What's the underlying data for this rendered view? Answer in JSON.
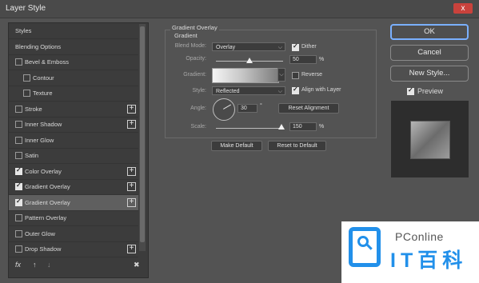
{
  "window": {
    "title": "Layer Style",
    "close_label": "x"
  },
  "styles_list": {
    "items": [
      {
        "label": "Styles",
        "checkbox": false,
        "checked": false,
        "plus": false,
        "indent": 0
      },
      {
        "label": "Blending Options",
        "checkbox": false,
        "checked": false,
        "plus": false,
        "indent": 0
      },
      {
        "label": "Bevel & Emboss",
        "checkbox": true,
        "checked": false,
        "plus": false,
        "indent": 0
      },
      {
        "label": "Contour",
        "checkbox": true,
        "checked": false,
        "plus": false,
        "indent": 1
      },
      {
        "label": "Texture",
        "checkbox": true,
        "checked": false,
        "plus": false,
        "indent": 1
      },
      {
        "label": "Stroke",
        "checkbox": true,
        "checked": false,
        "plus": true,
        "indent": 0
      },
      {
        "label": "Inner Shadow",
        "checkbox": true,
        "checked": false,
        "plus": true,
        "indent": 0
      },
      {
        "label": "Inner Glow",
        "checkbox": true,
        "checked": false,
        "plus": false,
        "indent": 0
      },
      {
        "label": "Satin",
        "checkbox": true,
        "checked": false,
        "plus": false,
        "indent": 0
      },
      {
        "label": "Color Overlay",
        "checkbox": true,
        "checked": true,
        "plus": true,
        "indent": 0
      },
      {
        "label": "Gradient Overlay",
        "checkbox": true,
        "checked": true,
        "plus": true,
        "indent": 0
      },
      {
        "label": "Gradient Overlay",
        "checkbox": true,
        "checked": true,
        "plus": true,
        "indent": 0,
        "selected": true
      },
      {
        "label": "Pattern Overlay",
        "checkbox": true,
        "checked": false,
        "plus": false,
        "indent": 0
      },
      {
        "label": "Outer Glow",
        "checkbox": true,
        "checked": false,
        "plus": false,
        "indent": 0
      },
      {
        "label": "Drop Shadow",
        "checkbox": true,
        "checked": false,
        "plus": true,
        "indent": 0
      }
    ],
    "tools": {
      "fx": "fx",
      "up": "↑",
      "down": "↓",
      "trash": "✖"
    }
  },
  "gradient_overlay": {
    "group_title": "Gradient Overlay",
    "subtitle": "Gradient",
    "blend_mode": {
      "label": "Blend Mode:",
      "value": "Overlay"
    },
    "dither": {
      "label": "Dither",
      "checked": true
    },
    "opacity": {
      "label": "Opacity:",
      "value": "50",
      "unit": "%",
      "level": 0.5
    },
    "gradient": {
      "label": "Gradient:"
    },
    "reverse": {
      "label": "Reverse",
      "checked": false
    },
    "style": {
      "label": "Style:",
      "value": "Reflected"
    },
    "align": {
      "label": "Align with Layer",
      "checked": true
    },
    "angle": {
      "label": "Angle:",
      "value": "30",
      "unit": "°",
      "degrees": 30
    },
    "reset_alignment": "Reset Alignment",
    "scale": {
      "label": "Scale:",
      "value": "150",
      "unit": "%",
      "level": 0.98
    },
    "make_default": "Make Default",
    "reset_default": "Reset to Default"
  },
  "right_buttons": {
    "ok": "OK",
    "cancel": "Cancel",
    "new_style": "New Style...",
    "preview_label": "Preview",
    "preview_checked": true
  },
  "watermark": {
    "brand": "PConline",
    "cn": "IT百科"
  },
  "colors": {
    "accent": "#7ab0ff",
    "watermark_blue": "#2290ea",
    "close_red": "#c9423c"
  }
}
